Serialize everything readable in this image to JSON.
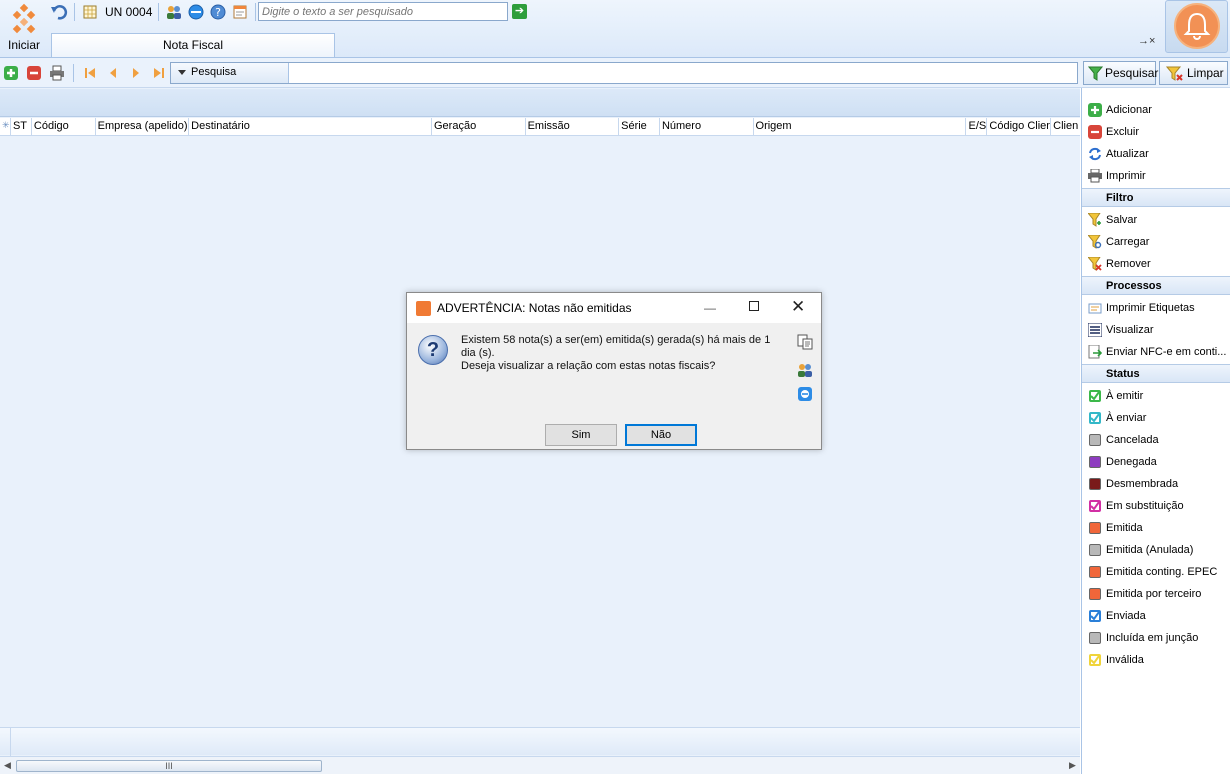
{
  "topbar": {
    "start_label": "Iniciar",
    "unit_label": "UN 0004",
    "search_placeholder": "Digite o texto a ser pesquisado",
    "tab_label": "Nota Fiscal",
    "tab_controls": "→×"
  },
  "toolbar": {
    "search_label": "Pesquisa",
    "search_button": "Pesquisar",
    "clear_button": "Limpar"
  },
  "grid": {
    "columns": [
      "ST",
      "Código",
      "Empresa (apelido)",
      "Destinatário",
      "Geração",
      "Emissão",
      "Série",
      "Número",
      "Origem",
      "E/S",
      "Código Clien",
      "Clien"
    ]
  },
  "sidebar": {
    "actions": [
      "Adicionar",
      "Excluir",
      "Atualizar",
      "Imprimir"
    ],
    "filter_header": "Filtro",
    "filter_items": [
      "Salvar",
      "Carregar",
      "Remover"
    ],
    "process_header": "Processos",
    "process_items": [
      "Imprimir Etiquetas",
      "Visualizar",
      "Enviar NFC-e em conti..."
    ],
    "status_header": "Status",
    "status_items": [
      {
        "label": "À emitir",
        "color": "#3cb84a",
        "checked": true
      },
      {
        "label": "À enviar",
        "color": "#33b8c8",
        "checked": true
      },
      {
        "label": "Cancelada",
        "color": "#b8b8b8",
        "checked": false
      },
      {
        "label": "Denegada",
        "color": "#8e3cc0",
        "checked": false
      },
      {
        "label": "Desmembrada",
        "color": "#7a1a1a",
        "checked": false
      },
      {
        "label": "Em substituição",
        "color": "#d22fa4",
        "checked": true
      },
      {
        "label": "Emitida",
        "color": "#f0663a",
        "checked": false
      },
      {
        "label": "Emitida (Anulada)",
        "color": "#b8b8b8",
        "checked": false
      },
      {
        "label": "Emitida conting. EPEC",
        "color": "#f0663a",
        "checked": false
      },
      {
        "label": "Emitida por terceiro",
        "color": "#f0663a",
        "checked": false
      },
      {
        "label": "Enviada",
        "color": "#2a7fd8",
        "checked": true
      },
      {
        "label": "Incluída em junção",
        "color": "#b8b8b8",
        "checked": false
      },
      {
        "label": "Inválida",
        "color": "#f0d43a",
        "checked": true
      }
    ]
  },
  "dialog": {
    "title": "ADVERTÊNCIA: Notas não emitidas",
    "message_line1": "Existem 58 nota(s) a ser(em) emitida(s) gerada(s) há mais de 1 dia (s).",
    "message_line2": "Deseja visualizar a relação com estas notas fiscais?",
    "yes_label": "Sim",
    "no_label": "Não"
  },
  "scrollbar": {
    "thumb_grip": "III"
  }
}
